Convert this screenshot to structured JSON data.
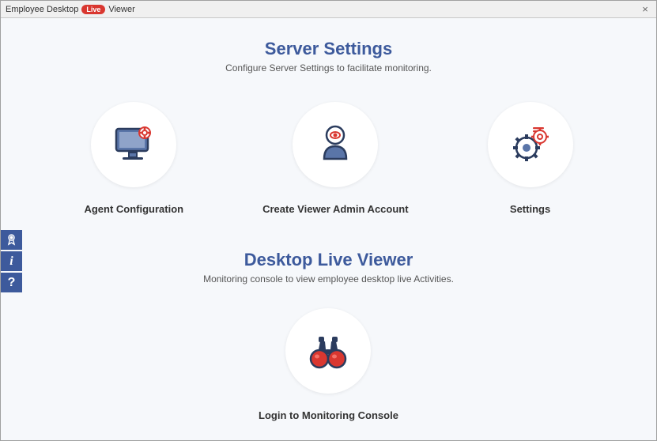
{
  "title": {
    "pre": "Employee Desktop",
    "badge": "Live",
    "post": "Viewer"
  },
  "sections": {
    "server": {
      "title": "Server Settings",
      "subtitle": "Configure Server Settings to facilitate monitoring.",
      "cards": {
        "agent": "Agent Configuration",
        "admin": "Create Viewer Admin Account",
        "settings": "Settings"
      }
    },
    "viewer": {
      "title": "Desktop Live Viewer",
      "subtitle": "Monitoring console to view employee desktop live Activities.",
      "cards": {
        "login": "Login to Monitoring Console"
      }
    }
  },
  "close_symbol": "×",
  "info_symbol": "i",
  "help_symbol": "?"
}
